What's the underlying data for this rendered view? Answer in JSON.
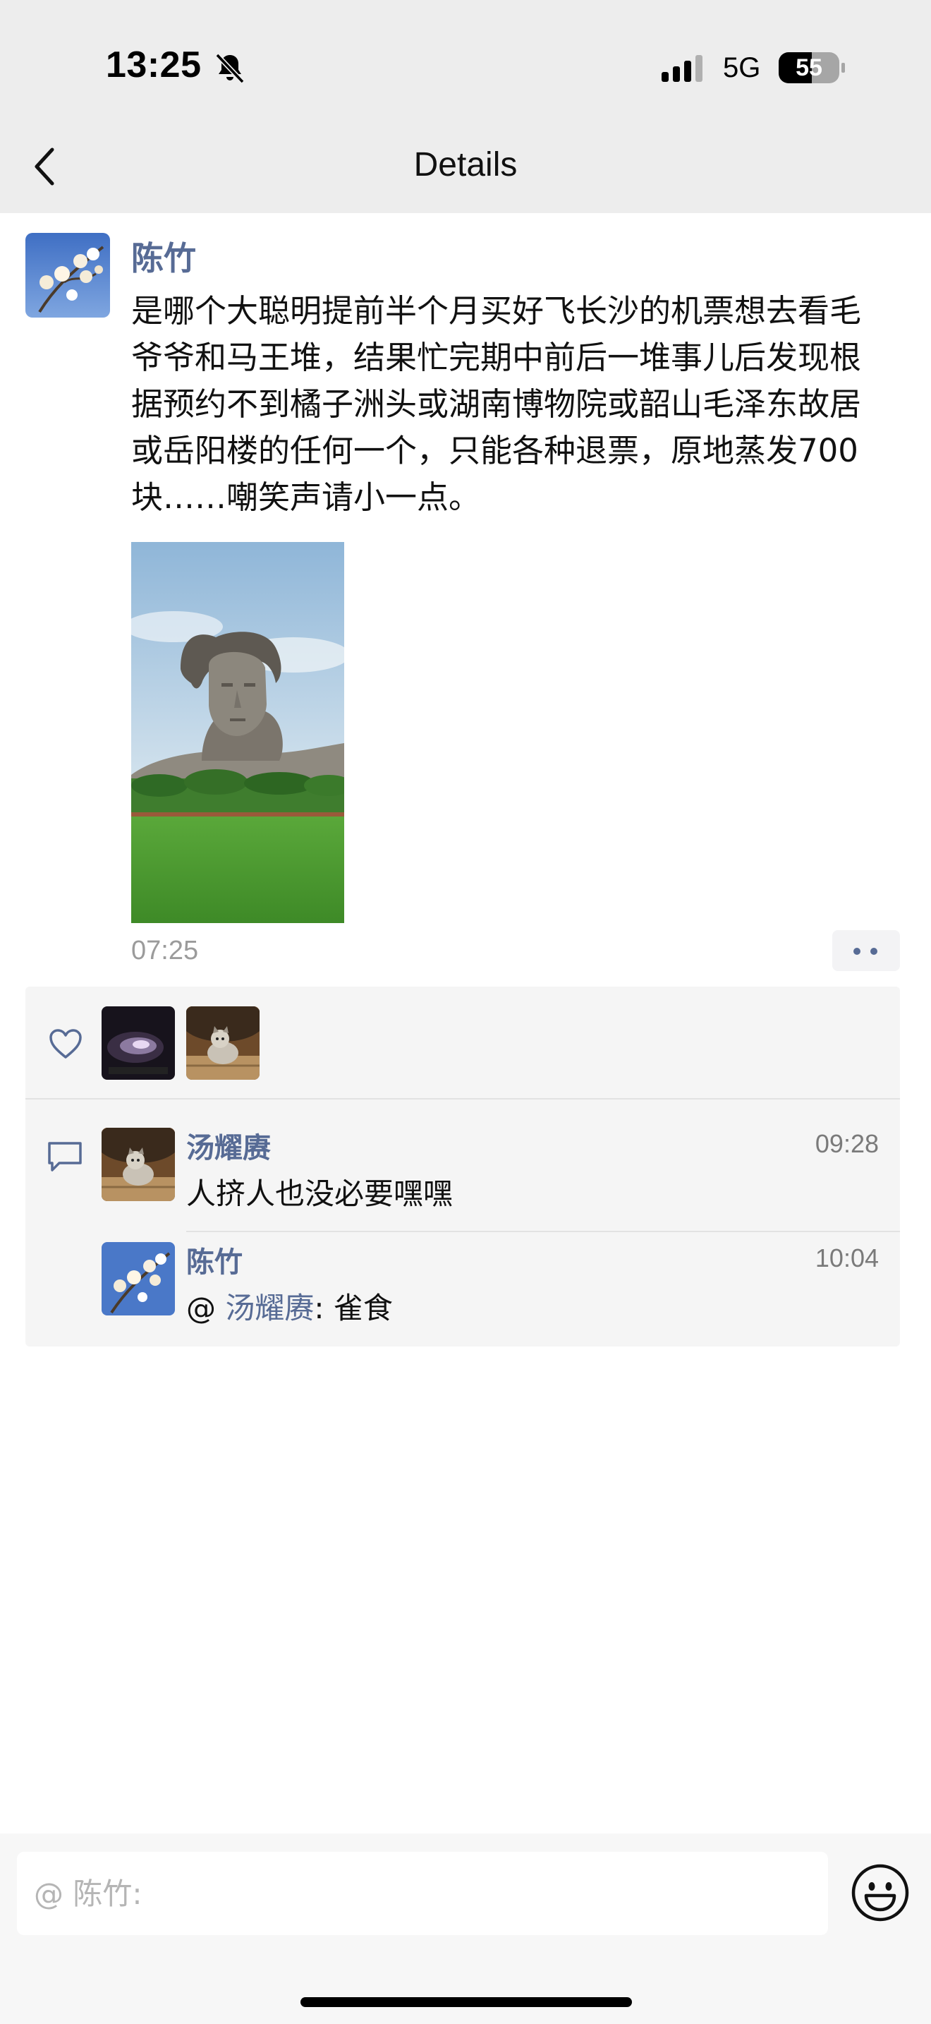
{
  "status_bar": {
    "time": "13:25",
    "network": "5G",
    "battery": "55"
  },
  "nav": {
    "title": "Details"
  },
  "post": {
    "author": "陈竹",
    "text": "是哪个大聪明提前半个月买好飞长沙的机票想去看毛爷爷和马王堆，结果忙完期中前后一堆事儿后发现根据预约不到橘子洲头或湖南博物院或韶山毛泽东故居或岳阳楼的任何一个，只能各种退票，原地蒸发700块……嘲笑声请小一点。",
    "time": "07:25"
  },
  "comments": [
    {
      "author": "汤耀赓",
      "time": "09:28",
      "text": "人挤人也没必要嘿嘿"
    },
    {
      "author": "陈竹",
      "time": "10:04",
      "prefix": "@ ",
      "mention": "汤耀赓",
      "text": ": 雀食"
    }
  ],
  "input": {
    "placeholder": "@ 陈竹:"
  },
  "icons": {
    "back": "chevron-left-icon",
    "bell": "bell-slash-icon",
    "signal": "signal-icon",
    "battery": "battery-icon",
    "like": "heart-icon",
    "comment": "comment-icon",
    "emoji": "smiley-icon"
  },
  "colors": {
    "link": "#576b95",
    "bar_bg": "#ededed",
    "panel_bg": "#f5f5f5"
  }
}
